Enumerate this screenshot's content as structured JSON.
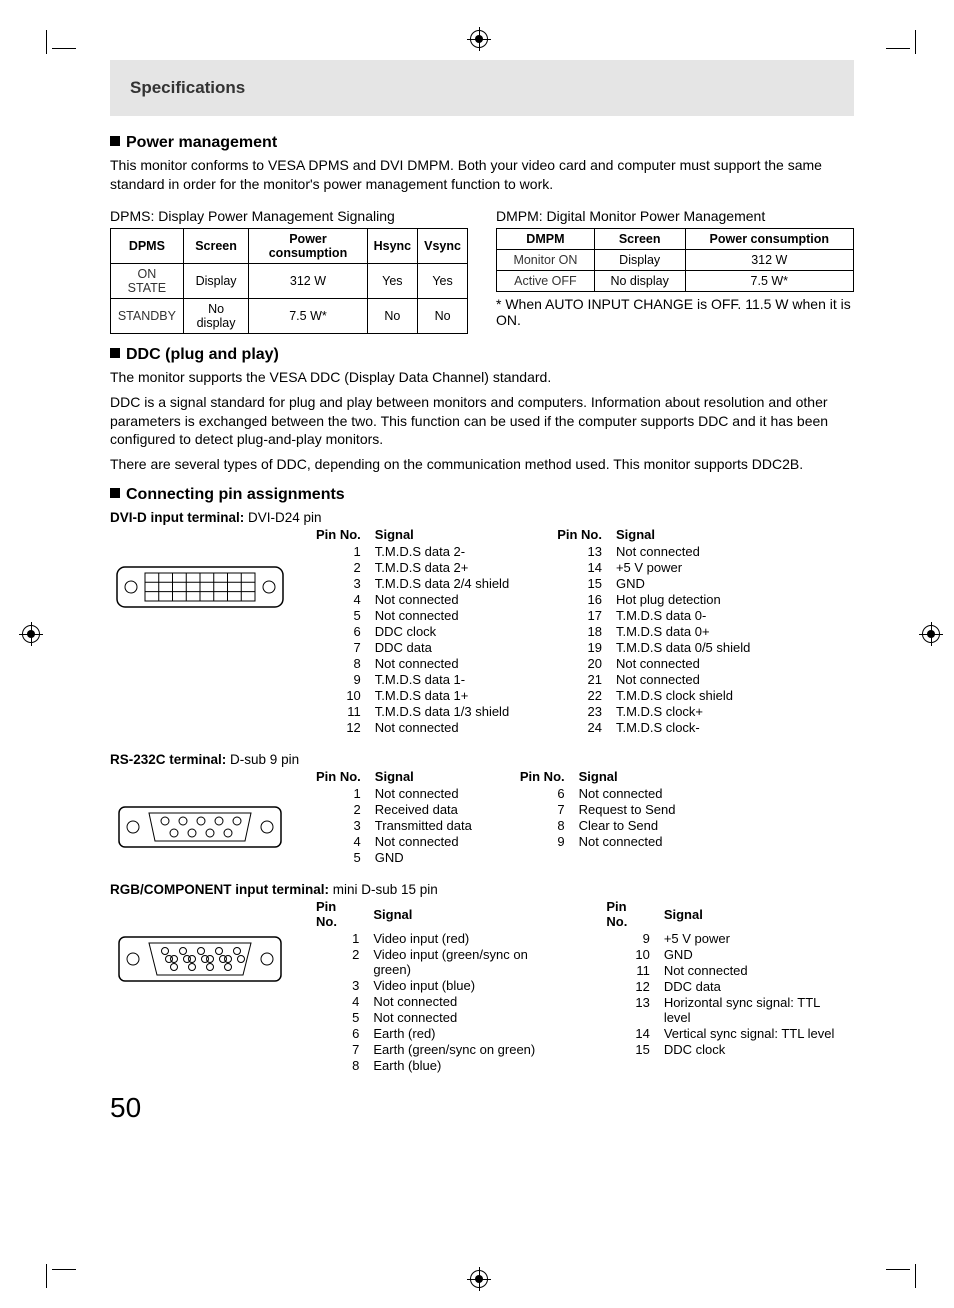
{
  "page_number": "50",
  "header_title": "Specifications",
  "sections": {
    "power": {
      "heading": "Power management",
      "body": "This monitor conforms to VESA DPMS and DVI DMPM. Both your video card and computer must support the same standard in order for the monitor's power management function to work.",
      "dpms_caption": "DPMS: Display Power Management Signaling",
      "dmpm_caption": "DMPM: Digital Monitor Power Management",
      "dpms_table": {
        "headers": [
          "DPMS",
          "Screen",
          "Power consumption",
          "Hsync",
          "Vsync"
        ],
        "rows": [
          [
            "ON STATE",
            "Display",
            "312 W",
            "Yes",
            "Yes"
          ],
          [
            "STANDBY",
            "No display",
            "7.5 W*",
            "No",
            "No"
          ]
        ]
      },
      "dmpm_table": {
        "headers": [
          "DMPM",
          "Screen",
          "Power consumption"
        ],
        "rows": [
          [
            "Monitor ON",
            "Display",
            "312 W"
          ],
          [
            "Active OFF",
            "No display",
            "7.5 W*"
          ]
        ]
      },
      "footnote": "* When AUTO INPUT CHANGE is OFF. 11.5 W when it is ON."
    },
    "ddc": {
      "heading": "DDC (plug and play)",
      "body1": "The monitor supports the VESA DDC (Display Data Channel) standard.",
      "body2": "DDC is a signal standard for plug and play between monitors and computers. Information about resolution and other parameters is exchanged between the two. This function can be used if the computer supports DDC and it has been configured to detect plug-and-play monitors.",
      "body3": "There are several types of DDC, depending on the communication method used. This monitor supports DDC2B."
    },
    "pins": {
      "heading": "Connecting pin assignments",
      "col_pin": "Pin No.",
      "col_signal": "Signal",
      "dvi": {
        "label_bold": "DVI-D input terminal:",
        "label_rest": " DVI-D24 pin",
        "left": [
          {
            "n": "1",
            "s": "T.M.D.S data 2-"
          },
          {
            "n": "2",
            "s": "T.M.D.S data 2+"
          },
          {
            "n": "3",
            "s": "T.M.D.S data 2/4 shield"
          },
          {
            "n": "4",
            "s": "Not connected"
          },
          {
            "n": "5",
            "s": "Not connected"
          },
          {
            "n": "6",
            "s": "DDC clock"
          },
          {
            "n": "7",
            "s": "DDC data"
          },
          {
            "n": "8",
            "s": "Not connected"
          },
          {
            "n": "9",
            "s": "T.M.D.S data 1-"
          },
          {
            "n": "10",
            "s": "T.M.D.S data 1+"
          },
          {
            "n": "11",
            "s": "T.M.D.S data 1/3 shield"
          },
          {
            "n": "12",
            "s": "Not connected"
          }
        ],
        "right": [
          {
            "n": "13",
            "s": "Not connected"
          },
          {
            "n": "14",
            "s": "+5 V power"
          },
          {
            "n": "15",
            "s": "GND"
          },
          {
            "n": "16",
            "s": "Hot plug detection"
          },
          {
            "n": "17",
            "s": "T.M.D.S data 0-"
          },
          {
            "n": "18",
            "s": "T.M.D.S data 0+"
          },
          {
            "n": "19",
            "s": "T.M.D.S data 0/5 shield"
          },
          {
            "n": "20",
            "s": "Not connected"
          },
          {
            "n": "21",
            "s": "Not connected"
          },
          {
            "n": "22",
            "s": "T.M.D.S clock shield"
          },
          {
            "n": "23",
            "s": "T.M.D.S clock+"
          },
          {
            "n": "24",
            "s": "T.M.D.S clock-"
          }
        ]
      },
      "rs232c": {
        "label_bold": "RS-232C terminal:",
        "label_rest": " D-sub 9 pin",
        "left": [
          {
            "n": "1",
            "s": "Not connected"
          },
          {
            "n": "2",
            "s": "Received data"
          },
          {
            "n": "3",
            "s": "Transmitted data"
          },
          {
            "n": "4",
            "s": "Not connected"
          },
          {
            "n": "5",
            "s": "GND"
          }
        ],
        "right": [
          {
            "n": "6",
            "s": "Not connected"
          },
          {
            "n": "7",
            "s": "Request to Send"
          },
          {
            "n": "8",
            "s": "Clear to Send"
          },
          {
            "n": "9",
            "s": "Not connected"
          }
        ]
      },
      "rgb": {
        "label_bold": "RGB/COMPONENT input terminal:",
        "label_rest": " mini D-sub 15 pin",
        "left": [
          {
            "n": "1",
            "s": "Video input (red)"
          },
          {
            "n": "2",
            "s": "Video input (green/sync on green)"
          },
          {
            "n": "3",
            "s": "Video input (blue)"
          },
          {
            "n": "4",
            "s": "Not connected"
          },
          {
            "n": "5",
            "s": "Not connected"
          },
          {
            "n": "6",
            "s": "Earth (red)"
          },
          {
            "n": "7",
            "s": "Earth (green/sync on green)"
          },
          {
            "n": "8",
            "s": "Earth (blue)"
          }
        ],
        "right": [
          {
            "n": "9",
            "s": "+5 V power"
          },
          {
            "n": "10",
            "s": "GND"
          },
          {
            "n": "11",
            "s": "Not connected"
          },
          {
            "n": "12",
            "s": "DDC data"
          },
          {
            "n": "13",
            "s": "Horizontal sync signal: TTL level"
          },
          {
            "n": "14",
            "s": "Vertical sync signal: TTL level"
          },
          {
            "n": "15",
            "s": "DDC clock"
          }
        ]
      }
    }
  }
}
